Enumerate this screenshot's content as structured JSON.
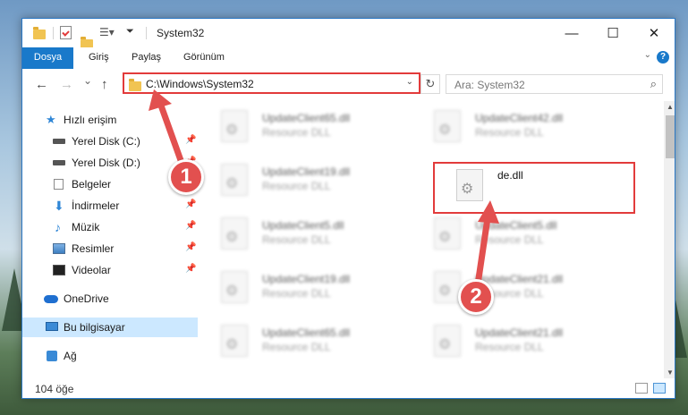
{
  "window": {
    "title": "System32",
    "controls": {
      "minimize": "—",
      "maximize": "☐",
      "close": "✕"
    }
  },
  "ribbon": {
    "tabs": [
      "Dosya",
      "Giriş",
      "Paylaş",
      "Görünüm"
    ],
    "help": "?"
  },
  "nav": {
    "back": "←",
    "forward": "→",
    "recent": "⌄",
    "up": "↑",
    "address_path": "C:\\Windows\\System32",
    "refresh": "↻",
    "search_placeholder": "Ara: System32"
  },
  "sidebar": {
    "items": [
      {
        "label": "Hızlı erişim",
        "icon": "star-icon"
      },
      {
        "label": "Yerel Disk (C:)",
        "icon": "disk-icon",
        "pinned": true
      },
      {
        "label": "Yerel Disk (D:)",
        "icon": "disk-icon",
        "pinned": true
      },
      {
        "label": "Belgeler",
        "icon": "documents-icon",
        "pinned": true
      },
      {
        "label": "İndirmeler",
        "icon": "downloads-icon",
        "pinned": true
      },
      {
        "label": "Müzik",
        "icon": "music-icon",
        "pinned": true
      },
      {
        "label": "Resimler",
        "icon": "pictures-icon",
        "pinned": true
      },
      {
        "label": "Videolar",
        "icon": "videos-icon",
        "pinned": true
      },
      {
        "label": "OneDrive",
        "icon": "onedrive-icon"
      },
      {
        "label": "Bu bilgisayar",
        "icon": "this-pc-icon",
        "selected": true
      },
      {
        "label": "Ağ",
        "icon": "network-icon"
      }
    ],
    "pin_glyph": "📌"
  },
  "files": [
    {
      "name": "UpdateClient65.dll",
      "type": "Resource DLL"
    },
    {
      "name": "UpdateClient42.dll",
      "type": "Resource DLL"
    },
    {
      "name": "UpdateClient19.dll",
      "type": "Resource DLL"
    },
    {
      "name": "de.dll",
      "type": ""
    },
    {
      "name": "UpdateClient5.dll",
      "type": "Resource DLL"
    },
    {
      "name": "UpdateClient5.dll",
      "type": "Resource DLL"
    },
    {
      "name": "UpdateClient19.dll",
      "type": "Resource DLL"
    },
    {
      "name": "UpdateClient21.dll",
      "type": "Resource DLL"
    },
    {
      "name": "UpdateClient65.dll",
      "type": "Resource DLL"
    },
    {
      "name": "UpdateClient21.dll",
      "type": "Resource DLL"
    }
  ],
  "status": {
    "item_count": "104 öğe"
  },
  "annotations": {
    "step1": "1",
    "step2": "2"
  },
  "colors": {
    "accent": "#1979ca",
    "annotation_red": "#e23b3b",
    "selection": "#cce8ff"
  }
}
